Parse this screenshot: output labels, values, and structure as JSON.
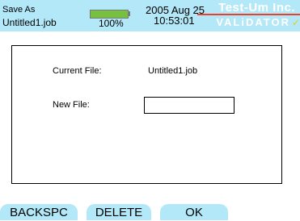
{
  "header": {
    "title": "Save As",
    "filename": "Untitled1.job",
    "battery_percent_label": "100%",
    "battery_level": 1.0,
    "date": "2005 Aug 25",
    "time": "10:53:01",
    "brand_name": "Test-Um Inc.",
    "brand_product": "VALiDATOR",
    "brand_check_icon": "checkmark-icon"
  },
  "panel": {
    "current_file_label": "Current File:",
    "current_file_value": "Untitled1.job",
    "new_file_label": "New File:",
    "new_file_value": ""
  },
  "softkeys": {
    "backspace": "BACKSPC",
    "delete": "DELETE",
    "ok": "OK"
  },
  "colors": {
    "accent": "#b3e8f8",
    "battery": "#78c040",
    "brand_line": "#e8402a",
    "check": "#f0c81e"
  }
}
